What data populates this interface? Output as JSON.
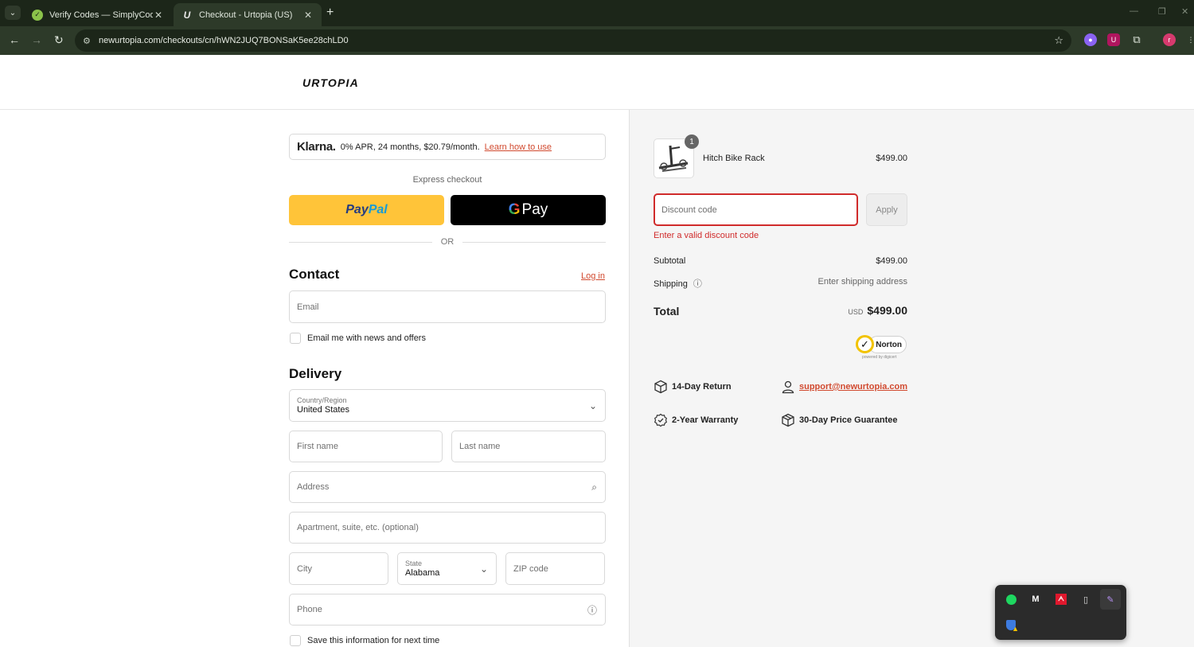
{
  "browser": {
    "tabs": [
      {
        "title": "Verify Codes — SimplyCodes",
        "active": false
      },
      {
        "title": "Checkout - Urtopia (US)",
        "active": true
      }
    ],
    "url": "newurtopia.com/checkouts/cn/hWN2JUQ7BONSaK5ee28chLD0",
    "profile_initial": "r"
  },
  "brand": {
    "logo": "URTOPIA",
    "accent": "#d1492e",
    "error": "#d02b2b"
  },
  "klarna": {
    "brand": "Klarna.",
    "offer": "0% APR, 24 months, $20.79/month.",
    "link": "Learn how to use"
  },
  "express": {
    "label": "Express checkout",
    "paypal": {
      "pay": "Pay",
      "pal": "Pal"
    },
    "gpay": {
      "g": "G",
      "label": "Pay"
    },
    "or": "OR"
  },
  "contact": {
    "heading": "Contact",
    "login": "Log in",
    "email_placeholder": "Email",
    "newsletter_label": "Email me with news and offers"
  },
  "delivery": {
    "heading": "Delivery",
    "country_label": "Country/Region",
    "country_value": "United States",
    "first_name": "First name",
    "last_name": "Last name",
    "address": "Address",
    "apartment": "Apartment, suite, etc. (optional)",
    "city": "City",
    "state_label": "State",
    "state_value": "Alabama",
    "zip": "ZIP code",
    "phone": "Phone",
    "save_label": "Save this information for next time"
  },
  "summary": {
    "item": {
      "name": "Hitch Bike Rack",
      "price": "$499.00",
      "qty": "1"
    },
    "discount_placeholder": "Discount code",
    "apply": "Apply",
    "error": "Enter a valid discount code",
    "subtotal_label": "Subtotal",
    "subtotal_value": "$499.00",
    "shipping_label": "Shipping",
    "shipping_value": "Enter shipping address",
    "total_label": "Total",
    "total_currency": "USD",
    "total_value": "$499.00",
    "norton": {
      "name": "Norton",
      "sub": "powered by digicert"
    },
    "features": [
      {
        "label": "14-Day Return",
        "icon": "box-return-icon"
      },
      {
        "label": "support@newurtopia.com",
        "icon": "user-support-icon"
      },
      {
        "label": "2-Year Warranty",
        "icon": "warranty-badge-icon"
      },
      {
        "label": "30-Day Price Guarantee",
        "icon": "box-guarantee-icon"
      }
    ]
  },
  "tray": {
    "icons": [
      "spotify-icon",
      "gmail-icon",
      "amd-icon",
      "usb-drive-icon",
      "pen-icon",
      "security-warning-icon"
    ]
  }
}
